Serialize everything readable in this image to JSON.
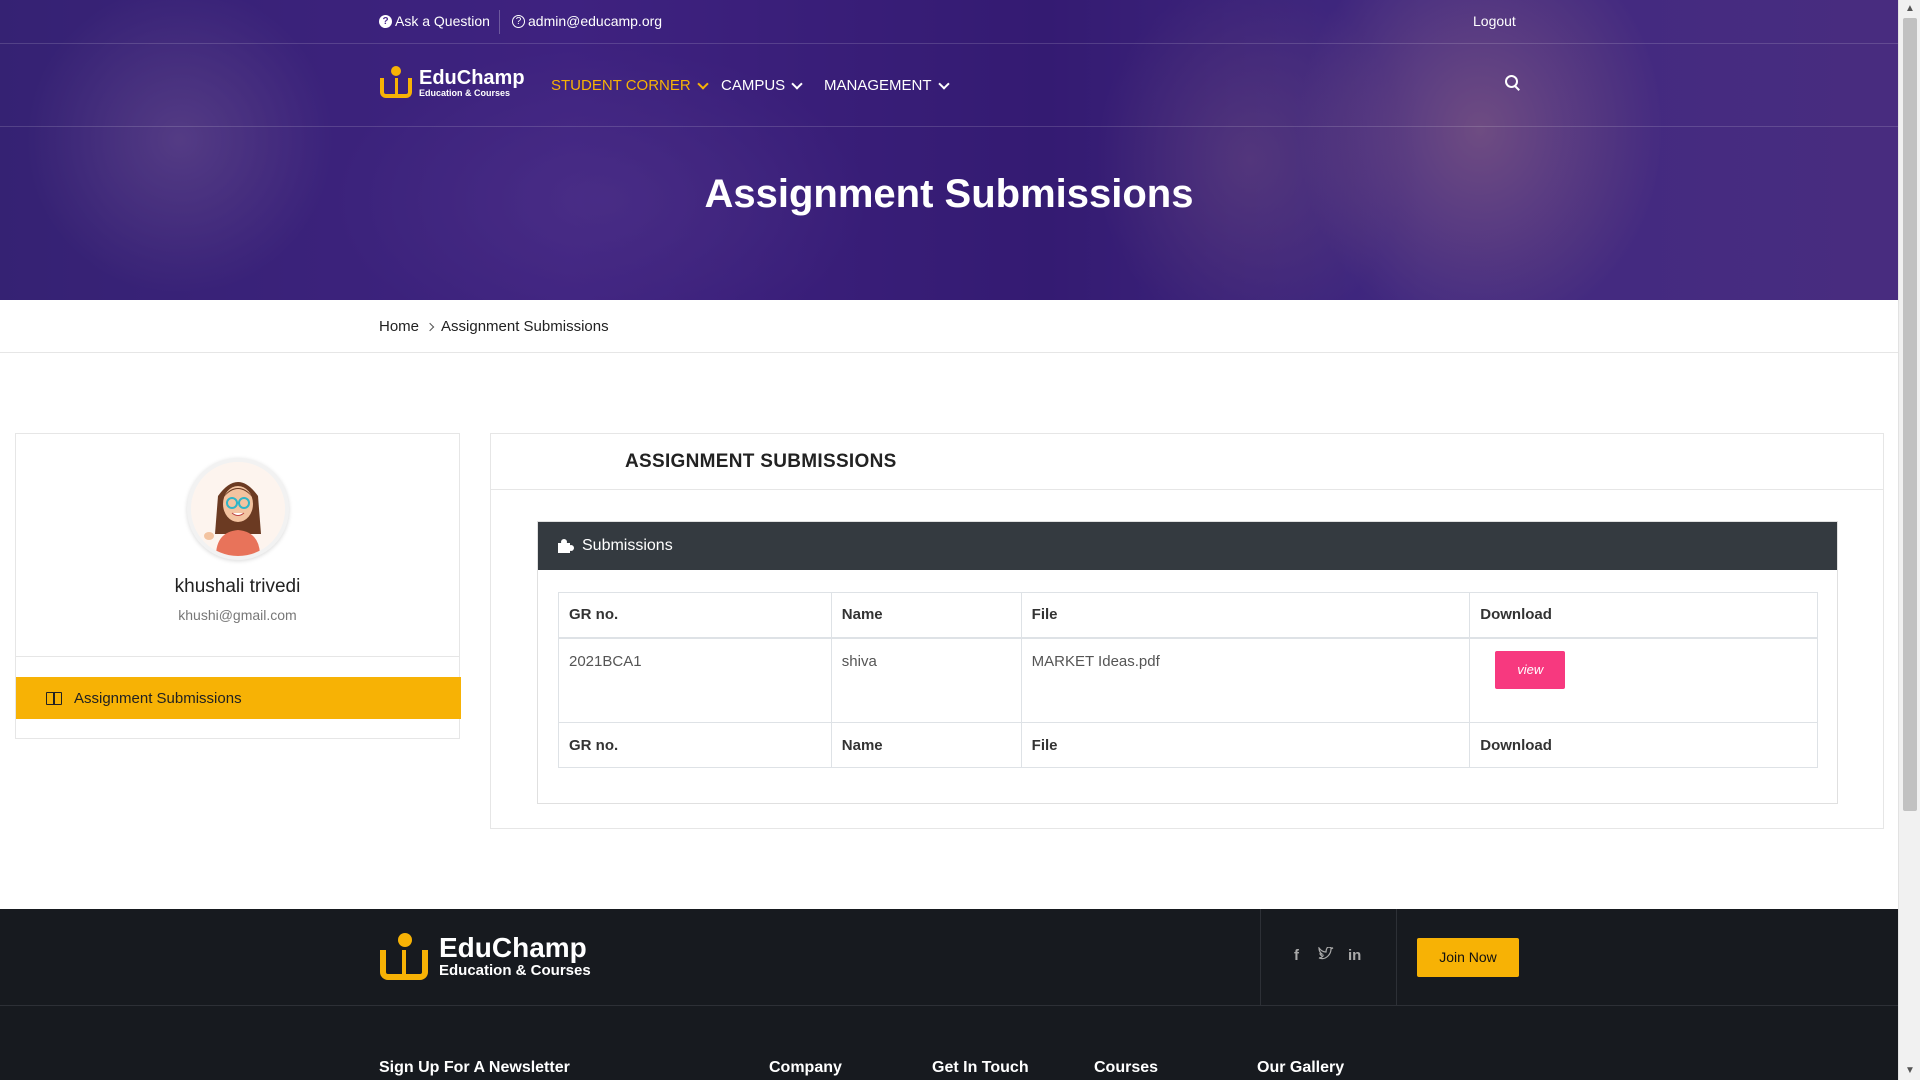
{
  "topbar": {
    "ask_question": "Ask a Question",
    "email": "admin@educamp.org",
    "logout": "Logout"
  },
  "brand": {
    "name": "EduChamp",
    "tagline": "Education & Courses"
  },
  "nav": {
    "items": [
      {
        "label": "STUDENT CORNER",
        "active": true
      },
      {
        "label": "CAMPUS",
        "active": false
      },
      {
        "label": "MANAGEMENT",
        "active": false
      }
    ]
  },
  "hero": {
    "title": "Assignment Submissions"
  },
  "breadcrumb": {
    "home": "Home",
    "current": "Assignment Submissions"
  },
  "profile": {
    "name": "khushali trivedi",
    "email": "khushi@gmail.com",
    "menu_item": "Assignment Submissions"
  },
  "main": {
    "title": "ASSIGNMENT SUBMISSIONS",
    "panel_title": "Submissions",
    "columns": [
      "GR no.",
      "Name",
      "File",
      "Download"
    ],
    "rows": [
      {
        "gr_no": "2021BCA1",
        "name": "shiva",
        "file": "MARKET Ideas.pdf",
        "action": "view"
      }
    ],
    "footer_columns": [
      "GR no.",
      "Name",
      "File",
      "Download"
    ]
  },
  "footer": {
    "brand_name": "EduChamp",
    "brand_tagline": "Education & Courses",
    "social_icons": [
      "facebook-icon",
      "twitter-icon",
      "linkedin-icon"
    ],
    "join_button": "Join Now",
    "columns": [
      "Sign Up For A Newsletter",
      "Company",
      "Get In Touch",
      "Courses",
      "Our Gallery"
    ]
  },
  "colors": {
    "accent": "#f7b205",
    "pink": "#f7397f",
    "panel_dark": "#343a40",
    "footer_bg": "#171a1f"
  }
}
